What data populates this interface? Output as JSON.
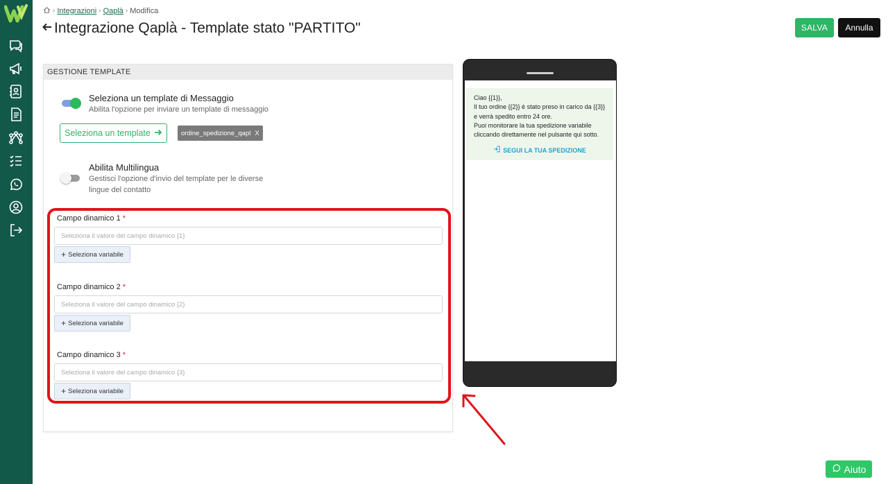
{
  "breadcrumb": {
    "items": [
      "Integrazioni",
      "Qaplà"
    ],
    "current": "Modifica"
  },
  "header": {
    "title": "Integrazione Qaplà - Template stato \"PARTITO\"",
    "save_label": "SALVA",
    "cancel_label": "Annulla"
  },
  "card": {
    "header": "GESTIONE TEMPLATE",
    "template_option": {
      "title": "Seleziona un template di Messaggio",
      "description": "Abilita l'opzione per inviare un template di messaggio",
      "enabled": true
    },
    "select_template_label": "Seleziona un template",
    "chip": {
      "label": "ordine_spedizione_qapl",
      "remove": "X"
    },
    "multilang_option": {
      "title": "Abilita Multilingua",
      "description_lines": [
        "Gestisci l'opzione d'invio del template per le diverse",
        "lingue del contatto"
      ],
      "enabled": false
    },
    "fields": [
      {
        "label": "Campo dinamico 1",
        "required_mark": "*",
        "placeholder": "Seleziona il valore del campo dinamico {1}",
        "button": "Seleziona variabile"
      },
      {
        "label": "Campo dinamico 2",
        "required_mark": "*",
        "placeholder": "Seleziona il valore del campo dinamico {2}",
        "button": "Seleziona variabile"
      },
      {
        "label": "Campo dinamico 3",
        "required_mark": "*",
        "placeholder": "Seleziona il valore del campo dinamico {3}",
        "button": "Seleziona variabile"
      }
    ]
  },
  "preview": {
    "message_lines": [
      "Ciao {{1}},",
      "Il tuo ordine {{2}} è stato preso in carico da {{3}}",
      "e verrà spedito entro 24 ore.",
      "Puoi monitorare la tua spedizione variabile",
      "cliccando direttamente nel pulsante qui sotto."
    ],
    "link_label": "SEGUI LA TUA SPEDIZIONE"
  },
  "help_label": "Aiuto",
  "colors": {
    "sidebar": "#13594a",
    "accent_green": "#2eb566",
    "highlight_red": "#e0141a",
    "link_blue": "#22a0d6"
  },
  "icons": [
    "chat-icon",
    "megaphone-icon",
    "contacts-icon",
    "document-icon",
    "workflow-icon",
    "checklist-icon",
    "whatsapp-icon",
    "user-icon",
    "logout-icon"
  ]
}
